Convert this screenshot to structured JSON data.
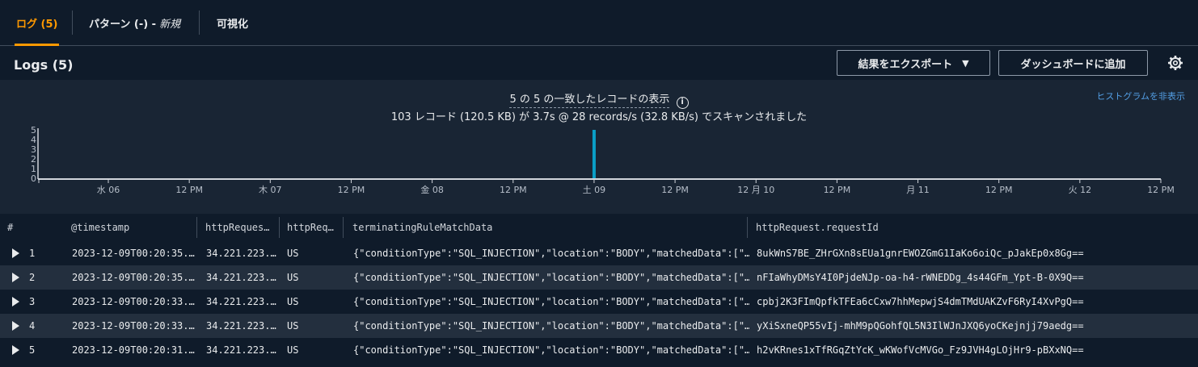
{
  "tabs": [
    {
      "label": "ログ (5)",
      "suffix": ""
    },
    {
      "label": "パターン (-) -",
      "suffix": "新規"
    },
    {
      "label": "可視化",
      "suffix": ""
    }
  ],
  "header": {
    "title": "Logs (5)",
    "export_label": "結果をエクスポート",
    "dashboard_label": "ダッシュボードに追加",
    "settings_icon": "gear-icon"
  },
  "histogram": {
    "summary_main": "5 の 5 の一致したレコードの表示",
    "summary_scan": "103 レコード (120.5 KB) が 3.7s @ 28 records/s (32.8 KB/s) でスキャンされました",
    "hide_label": "ヒストグラムを非表示",
    "info_icon": "info-icon"
  },
  "chart_data": {
    "type": "bar",
    "title": "",
    "xlabel": "",
    "ylabel": "",
    "ylim": [
      0,
      5
    ],
    "y_ticks": [
      "0",
      "1",
      "2",
      "3",
      "4",
      "5"
    ],
    "x_ticks": [
      "水 06",
      "12 PM",
      "木 07",
      "12 PM",
      "金 08",
      "12 PM",
      "土 09",
      "12 PM",
      "12 月 10",
      "12 PM",
      "月 11",
      "12 PM",
      "火 12",
      "12 PM"
    ],
    "bars": [
      {
        "x": "土 09 00:00",
        "value": 5
      }
    ],
    "bar_color": "#0972d3",
    "grid": false
  },
  "table": {
    "columns": [
      "#",
      "@timestamp",
      "httpReques…",
      "httpReq…",
      "terminatingRuleMatchData",
      "httpRequest.requestId"
    ],
    "rows": [
      {
        "n": "1",
        "ts": "2023-12-09T00:20:35.…",
        "ip": "34.221.223.…",
        "country": "US",
        "match": "{\"conditionType\":\"SQL_INJECTION\",\"location\":\"BODY\",\"matchedData\":[\"…",
        "reqid": "8ukWnS7BE_ZHrGXn8sEUa1gnrEWOZGmG1IaKo6oiQc_pJakEp0x8Gg=="
      },
      {
        "n": "2",
        "ts": "2023-12-09T00:20:35.…",
        "ip": "34.221.223.…",
        "country": "US",
        "match": "{\"conditionType\":\"SQL_INJECTION\",\"location\":\"BODY\",\"matchedData\":[\"…",
        "reqid": "nFIaWhyDMsY4I0PjdeNJp-oa-h4-rWNEDDg_4s44GFm_Ypt-B-0X9Q=="
      },
      {
        "n": "3",
        "ts": "2023-12-09T00:20:33.…",
        "ip": "34.221.223.…",
        "country": "US",
        "match": "{\"conditionType\":\"SQL_INJECTION\",\"location\":\"BODY\",\"matchedData\":[\"…",
        "reqid": "cpbj2K3FImQpfkTFEa6cCxw7hhMepwjS4dmTMdUAKZvF6RyI4XvPgQ=="
      },
      {
        "n": "4",
        "ts": "2023-12-09T00:20:33.…",
        "ip": "34.221.223.…",
        "country": "US",
        "match": "{\"conditionType\":\"SQL_INJECTION\",\"location\":\"BODY\",\"matchedData\":[\"…",
        "reqid": "yXiSxneQP55vIj-mhM9pQGohfQL5N3IlWJnJXQ6yoCKejnjj79aedg=="
      },
      {
        "n": "5",
        "ts": "2023-12-09T00:20:31.…",
        "ip": "34.221.223.…",
        "country": "US",
        "match": "{\"conditionType\":\"SQL_INJECTION\",\"location\":\"BODY\",\"matchedData\":[\"…",
        "reqid": "h2vKRnes1xTfRGqZtYcK_wKWofVcMVGo_Fz9JVH4gLOjHr9-pBXxNQ=="
      }
    ]
  }
}
